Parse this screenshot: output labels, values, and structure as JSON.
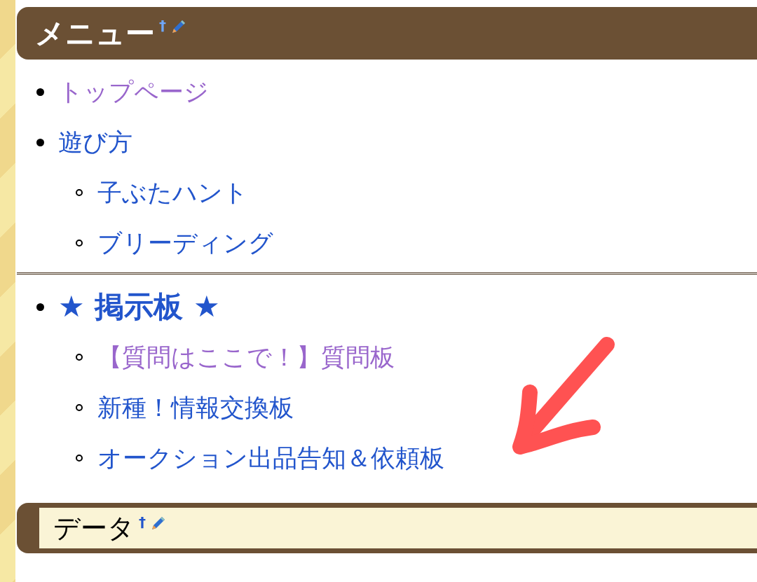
{
  "menu_heading": {
    "title": "メニュー",
    "anchor": "†"
  },
  "sections": [
    {
      "items": [
        {
          "kind": "link",
          "label": "トップページ",
          "visited": true
        },
        {
          "kind": "link",
          "label": "遊び方",
          "visited": false,
          "children": [
            {
              "label": "子ぶたハント",
              "visited": false
            },
            {
              "label": "ブリーディング",
              "visited": false
            }
          ]
        }
      ]
    },
    {
      "items": [
        {
          "kind": "heading",
          "label": "★ 掲示板 ★",
          "visited": false,
          "children": [
            {
              "label": "【質問はここで！】質問板",
              "visited": true
            },
            {
              "label": "新種！情報交換板",
              "visited": false
            },
            {
              "label": "オークション出品告知＆依頼板",
              "visited": false
            }
          ]
        }
      ]
    }
  ],
  "data_heading": {
    "title": "データ",
    "anchor": "†"
  }
}
